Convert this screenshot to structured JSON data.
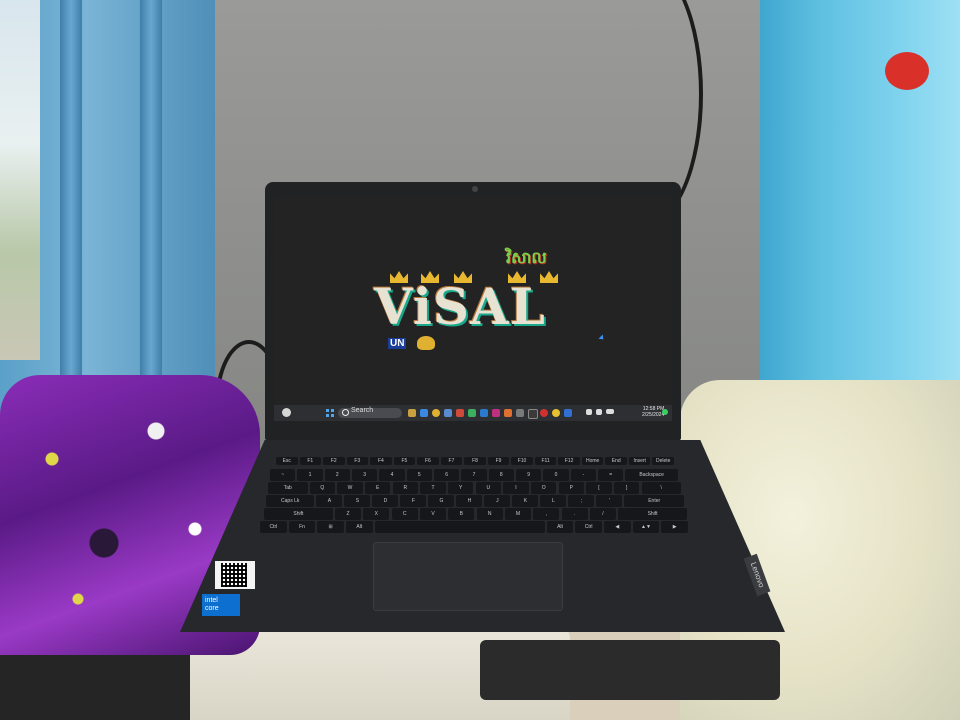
{
  "scene": {
    "description_objects": [
      "laptop",
      "window",
      "wall",
      "fabric",
      "plastic-bag",
      "cables"
    ]
  },
  "wallpaper": {
    "title": "ViSAL",
    "subtitle_khmer": "វិសាល",
    "badge": "UN"
  },
  "taskbar": {
    "search_placeholder": "Search",
    "time": "12:58 PM",
    "date": "2/25/2024"
  },
  "keyboard": {
    "rows": [
      [
        "Esc",
        "F1",
        "F2",
        "F3",
        "F4",
        "F5",
        "F6",
        "F7",
        "F8",
        "F9",
        "F10",
        "F11",
        "F12",
        "Home",
        "End",
        "Insert",
        "Delete"
      ],
      [
        "~",
        "1",
        "2",
        "3",
        "4",
        "5",
        "6",
        "7",
        "8",
        "9",
        "0",
        "-",
        "=",
        "Backspace"
      ],
      [
        "Tab",
        "Q",
        "W",
        "E",
        "R",
        "T",
        "Y",
        "U",
        "I",
        "O",
        "P",
        "[",
        "]",
        "\\"
      ],
      [
        "Caps Lk",
        "A",
        "S",
        "D",
        "F",
        "G",
        "H",
        "J",
        "K",
        "L",
        ";",
        "'",
        "Enter"
      ],
      [
        "Shift",
        "Z",
        "X",
        "C",
        "V",
        "B",
        "N",
        "M",
        ",",
        ".",
        "/",
        "Shift"
      ],
      [
        "Ctrl",
        "Fn",
        "⊞",
        "Alt",
        "",
        "Alt",
        "Ctrl",
        "◀",
        "▲▼",
        "▶"
      ]
    ]
  },
  "stickers": {
    "intel_line1": "intel",
    "intel_line2": "core",
    "brand": "Lenovo"
  },
  "colors": {
    "wall": "#8d8e8c",
    "window": "#5aa0c8",
    "cyan_panel": "#5fc0e0",
    "fabric": "#6a1e98",
    "laptop": "#26282b",
    "wallpaper_text": "#e8e2d2",
    "wallpaper_accent": "#1aa88a"
  },
  "icons": [
    "weather-icon",
    "start-icon",
    "search-icon",
    "file-explorer-icon",
    "edge-icon",
    "chrome-icon",
    "store-icon",
    "mail-icon",
    "settings-icon",
    "wifi-icon",
    "volume-icon",
    "battery-icon",
    "crown-icon",
    "cursor-icon",
    "qr-code",
    "intel-logo",
    "lenovo-logo"
  ]
}
